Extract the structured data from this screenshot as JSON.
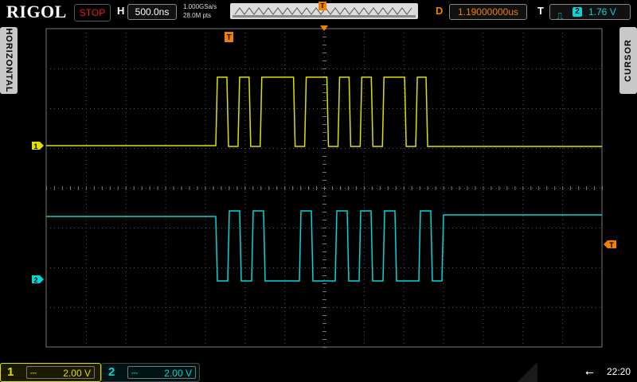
{
  "header": {
    "brand": "RIGOL",
    "run_status": "STOP",
    "h_label": "H",
    "timebase": "500.0ns",
    "sample_rate": "1.000GSa/s",
    "memory_depth": "28.0M pts",
    "trigger_marker": "T",
    "delay_label": "D",
    "delay_value": "1.19000000us",
    "trigger_label": "T",
    "trigger_edge": "rising-edge-icon",
    "trigger_source": "2",
    "trigger_level": "1.76 V"
  },
  "side_tabs": {
    "left": "HORIZONTAL",
    "right": "CURSOR"
  },
  "markers": {
    "ch1": "1",
    "ch2": "2",
    "trigger_pos": "T",
    "trigger_level": "T"
  },
  "channels": [
    {
      "number": "1",
      "scale": "2.00 V",
      "color": "#e0e000"
    },
    {
      "number": "2",
      "scale": "2.00 V",
      "color": "#00d8d8"
    }
  ],
  "status_bar": {
    "usb_icon": "usb-icon",
    "time": "22:20"
  },
  "colors": {
    "ch1": "#e0e000",
    "ch2": "#00d8d8",
    "trigger": "#f08000",
    "stop": "#e02020"
  },
  "waveforms": {
    "ch1_bits": [
      1,
      0,
      1,
      0,
      1,
      1,
      1,
      0,
      1,
      1,
      0,
      1,
      0,
      1,
      0,
      1,
      1,
      0,
      1
    ],
    "ch2_bits": [
      0,
      1,
      0,
      1,
      0,
      0,
      0,
      1,
      0,
      0,
      1,
      0,
      1,
      0,
      1,
      0,
      0,
      1,
      0
    ]
  }
}
